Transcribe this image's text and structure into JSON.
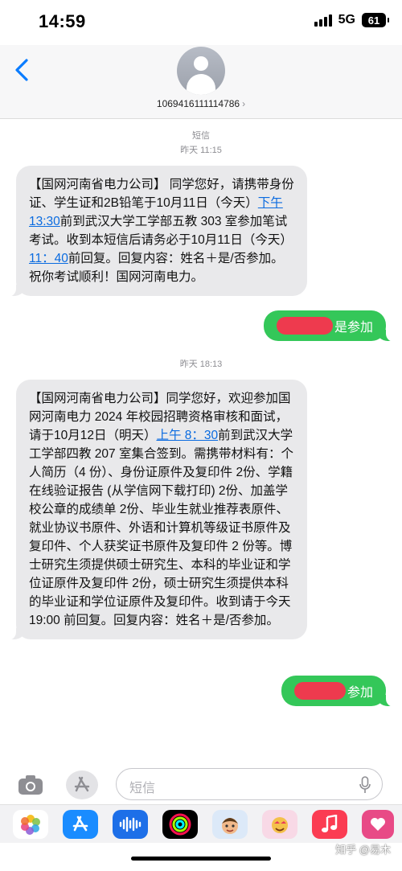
{
  "status": {
    "time": "14:59",
    "network": "5G",
    "battery": "61"
  },
  "header": {
    "contact": "1069416111114786"
  },
  "thread": {
    "service_label": "短信",
    "timestamp1": "昨天 11:15",
    "msg1": {
      "p1": "【国网河南省电力公司】 同学您好，请携带身份证、学生证和2B铅笔于10月11日（今天）",
      "link1": "下午 13:30",
      "p2": "前到武汉大学工学部五教 303 室参加笔试考试。收到本短信后请务必于10月11日（今天）",
      "link2": "11：40",
      "p3": "前回复。回复内容：姓名＋是/否参加。祝你考试顺利！国网河南电力。"
    },
    "reply1": "是参加",
    "timestamp2": "昨天 18:13",
    "msg2": {
      "p1": "【国网河南省电力公司】同学您好，欢迎参加国网河南电力 2024 年校园招聘资格审核和面试，请于10月12日（明天）",
      "link1": "上午 8：30",
      "p2": "前到武汉大学工学部四教 207 室集合签到。需携带材料有：个人简历（4 份）、身份证原件及复印件 2份、学籍在线验证报告 (从学信网下载打印) 2份、加盖学校公章的成绩单 2份、毕业生就业推荐表原件、就业协议书原件、外语和计算机等级证书原件及复印件、个人获奖证书原件及复印件 2 份等。博士研究生须提供硕士研究生、本科的毕业证和学位证原件及复印件 2份，硕士研究生须提供本科的毕业证和学位证原件及复印件。收到请于今天 19:00 前回复。回复内容：姓名＋是/否参加。"
    },
    "reply2": "参加"
  },
  "input": {
    "placeholder": "短信"
  },
  "watermark": "知乎 @易木",
  "colors": {
    "sent_bubble": "#34c759",
    "received_bubble": "#e9e9eb",
    "link": "#0a6be0",
    "redaction": "#ee3a4e"
  },
  "dock": [
    "photos-icon",
    "app-store-icon",
    "audio-message-icon",
    "fitness-icon",
    "memoji-icon",
    "memoji-stickers-icon",
    "music-icon",
    "more-apps-icon"
  ]
}
